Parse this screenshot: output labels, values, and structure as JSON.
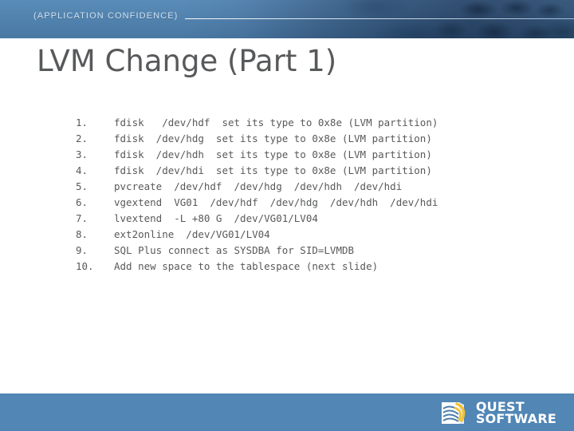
{
  "header": {
    "tagline": "(APPLICATION CONFIDENCE)",
    "band_color": "#5186b5",
    "texture_color": "#28466a",
    "rule_color": "#ffffff"
  },
  "title": "LVM Change (Part 1)",
  "title_color": "#58595b",
  "body": {
    "text_color": "#58595b",
    "items": [
      {
        "number": "1.",
        "text": "fdisk   /dev/hdf  set its type to 0x8e (LVM partition)"
      },
      {
        "number": "2.",
        "text": "fdisk  /dev/hdg  set its type to 0x8e (LVM partition)"
      },
      {
        "number": "3.",
        "text": "fdisk  /dev/hdh  set its type to 0x8e (LVM partition)"
      },
      {
        "number": "4.",
        "text": "fdisk  /dev/hdi  set its type to 0x8e (LVM partition)"
      },
      {
        "number": "5.",
        "text": "pvcreate  /dev/hdf  /dev/hdg  /dev/hdh  /dev/hdi"
      },
      {
        "number": "6.",
        "text": "vgextend  VG01  /dev/hdf  /dev/hdg  /dev/hdh  /dev/hdi"
      },
      {
        "number": "7.",
        "text": "lvextend  -L +80 G  /dev/VG01/LV04"
      },
      {
        "number": "8.",
        "text": "ext2online  /dev/VG01/LV04"
      },
      {
        "number": "9.",
        "text": "SQL Plus connect as SYSDBA for SID=LVMDB"
      },
      {
        "number": "10.",
        "text": "Add new space to the tablespace (next slide)"
      }
    ]
  },
  "footer": {
    "band_color": "#5186b5",
    "logo": {
      "line1": "QUEST",
      "line2": "SOFTWARE",
      "text_color": "#ffffff",
      "accent_color": "#f2c230"
    }
  }
}
